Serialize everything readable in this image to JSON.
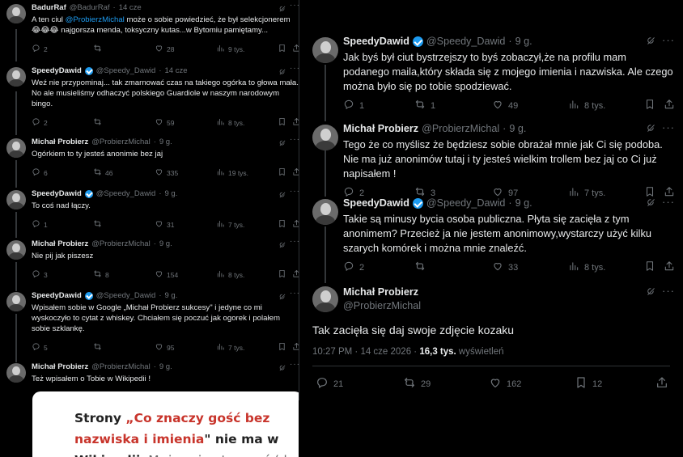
{
  "left": {
    "tweets": [
      {
        "name": "BadurRaf",
        "verified": false,
        "handle": "@BadurRaf",
        "time": "14 cze",
        "text_pre": "A ten ciul ",
        "mention": "@ProbierzMichal",
        "text_post": " może o sobie powiedzieć, że był selekcjonerem 😂😂😂 najgorsza menda, toksyczny kutas...w Bytomiu pamiętamy...",
        "replies": "2",
        "reposts": "",
        "likes": "28",
        "views": "9 tys."
      },
      {
        "name": "SpeedyDawid",
        "verified": true,
        "handle": "@Speedy_Dawid",
        "time": "14 cze",
        "text": "Weź nie przypominaj... tak zmarnować czas na takiego ogórka to głowa mała. No ale musieliśmy odhaczyć polskiego Guardiole w naszym narodowym bingo.",
        "replies": "2",
        "reposts": "",
        "likes": "59",
        "views": "8 tys."
      },
      {
        "name": "Michał Probierz",
        "verified": false,
        "handle": "@ProbierzMichal",
        "time": "9 g.",
        "text": "Ogórkiem to ty jesteś anonimie bez jaj",
        "replies": "6",
        "reposts": "46",
        "likes": "335",
        "views": "19 tys."
      },
      {
        "name": "SpeedyDawid",
        "verified": true,
        "handle": "@Speedy_Dawid",
        "time": "9 g.",
        "text": "To coś nad łączy.",
        "replies": "1",
        "reposts": "",
        "likes": "31",
        "views": "7 tys."
      },
      {
        "name": "Michał Probierz",
        "verified": false,
        "handle": "@ProbierzMichal",
        "time": "9 g.",
        "text": "Nie pij jak piszesz",
        "replies": "3",
        "reposts": "8",
        "likes": "154",
        "views": "8 tys."
      },
      {
        "name": "SpeedyDawid",
        "verified": true,
        "handle": "@Speedy_Dawid",
        "time": "9 g.",
        "text": "Wpisałem sobie w Google „Michał Probierz sukcesy\" i jedyne co mi wyskoczyło to cytat z whiskey. Chciałem się poczuć jak ogorek i polałem sobie szklankę.",
        "replies": "5",
        "reposts": "",
        "likes": "95",
        "views": "7 tys."
      },
      {
        "name": "Michał Probierz",
        "verified": false,
        "handle": "@ProbierzMichal",
        "time": "9 g.",
        "text": "Też wpisałem o Tobie w Wikipedii !",
        "replies": "",
        "reposts": "",
        "likes": "",
        "views": ""
      }
    ],
    "card": {
      "line1_pre": "Strony ",
      "line1_red": "„Co znaczy gość bez",
      "line2_red": "nazwiska i imienia",
      "line2_post": "\" nie ma w",
      "line3_bold": "Wikipedii",
      "line3_grey": ". Możesz ją utworzyć (do"
    }
  },
  "right": {
    "tweets": [
      {
        "name": "SpeedyDawid",
        "verified": true,
        "handle": "@Speedy_Dawid",
        "time": "9 g.",
        "text": "Jak byś był ciut bystrzejszy to byś zobaczył,że na profilu mam podanego maila,który składa się z mojego imienia i nazwiska. Ale czego można było się po tobie spodziewać.",
        "replies": "1",
        "reposts": "1",
        "likes": "49",
        "views": "8 tys."
      },
      {
        "name": "Michał Probierz",
        "verified": false,
        "handle": "@ProbierzMichal",
        "time": "9 g.",
        "text": "Tego że co myślisz że będziesz sobie obrażał mnie jak Ci się podoba. Nie ma już anonimów tutaj i ty jesteś wielkim trollem bez jaj co Ci już napisałem !",
        "replies": "2",
        "reposts": "3",
        "likes": "97",
        "views": "7 tys."
      },
      {
        "name": "SpeedyDawid",
        "verified": true,
        "handle": "@Speedy_Dawid",
        "time": "9 g.",
        "text": "Takie są minusy bycia osoba publiczna. Płyta się zacięła z tym anonimem? Przecież ja nie jestem anonimowy,wystarczy użyć kilku szarych komórek i można mnie znaleźć.",
        "replies": "2",
        "reposts": "",
        "likes": "33",
        "views": "8 tys."
      }
    ],
    "main": {
      "name": "Michał Probierz",
      "handle": "@ProbierzMichal",
      "text": "Tak zacięła się daj swoje zdjęcie kozaku",
      "timestamp": "10:27 PM · 14 cze 2026 · ",
      "views_count": "16,3 tys.",
      "views_label": " wyświetleń",
      "replies": "21",
      "reposts": "29",
      "likes": "162",
      "bookmarks": "12"
    }
  },
  "colors": {
    "accent": "#1d9bf0",
    "text": "#e7e9ea",
    "muted": "#71767b",
    "background": "#000000",
    "card_red": "#c8342b"
  },
  "icons": [
    "reply-icon",
    "repost-icon",
    "like-icon",
    "views-icon",
    "bookmark-icon",
    "share-icon",
    "grok-icon",
    "more-icon",
    "verified-icon"
  ]
}
